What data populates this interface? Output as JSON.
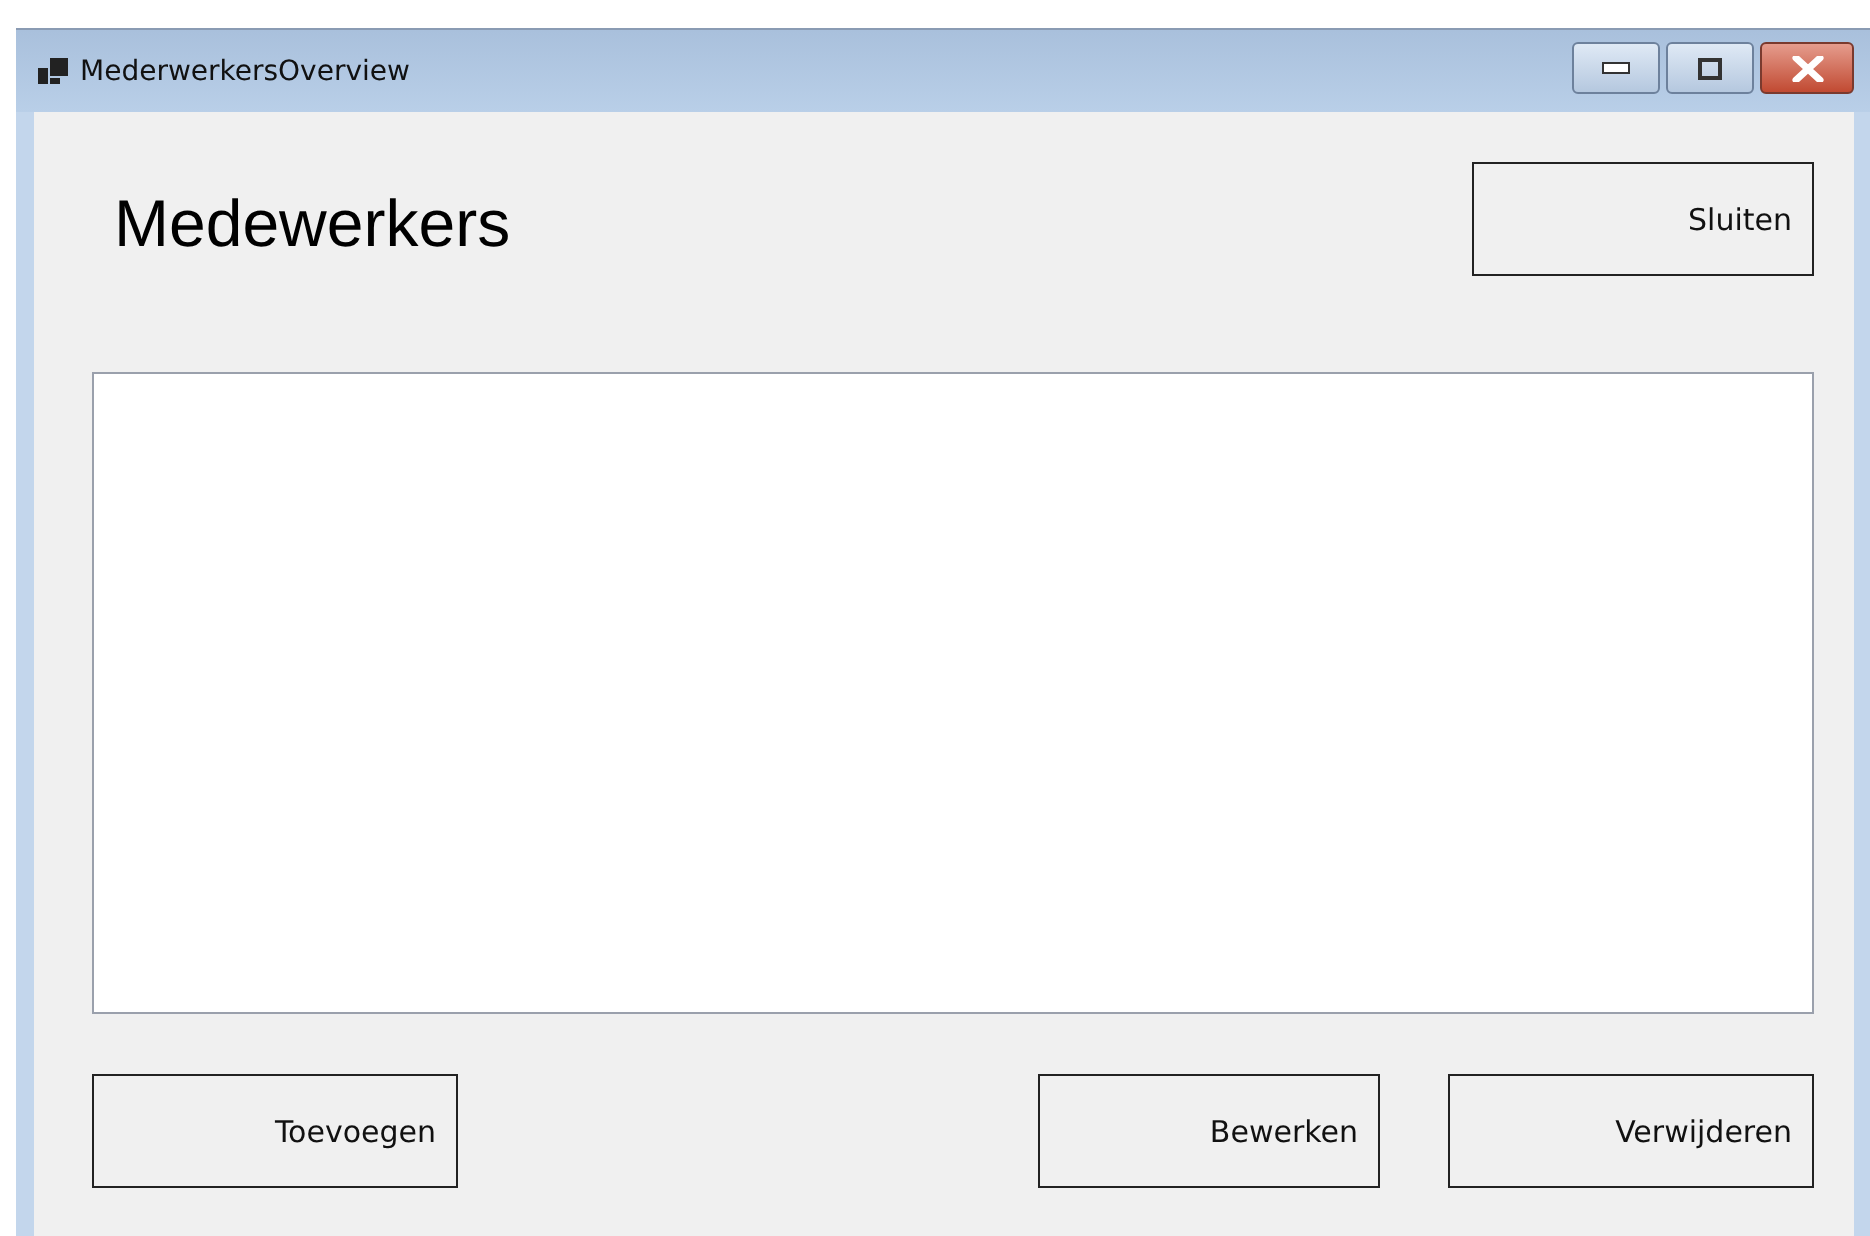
{
  "window": {
    "title": "MederwerkersOverview"
  },
  "heading": "Medewerkers",
  "close_button": "Sluiten",
  "buttons": [
    {
      "label": "Toevoegen"
    },
    {
      "label": "Bewerken"
    },
    {
      "label": "Verwijderen"
    }
  ]
}
